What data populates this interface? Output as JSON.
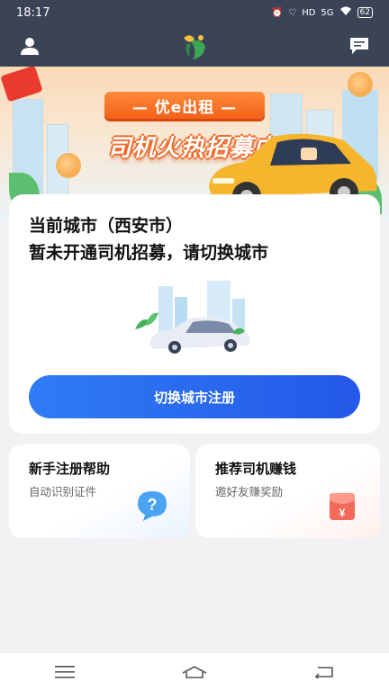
{
  "status_bar": {
    "time": "18:17",
    "network": "5G",
    "battery": "62"
  },
  "header": {
    "user_icon": "user-icon",
    "logo_icon": "app-logo",
    "message_icon": "message-icon"
  },
  "banner": {
    "brand": "— 优e出租 —",
    "headline": "司机火热招募中"
  },
  "city_card": {
    "title": "当前城市（西安市）",
    "subtitle": "暂未开通司机招募，请切换城市",
    "button_label": "切换城市注册"
  },
  "cards": [
    {
      "title": "新手注册帮助",
      "subtitle": "自动识别证件",
      "icon": "question-bubble-icon"
    },
    {
      "title": "推荐司机赚钱",
      "subtitle": "邀好友赚奖励",
      "icon": "red-envelope-icon"
    }
  ],
  "colors": {
    "header_bg": "#3b4357",
    "accent_blue": "#2f7cf6",
    "accent_orange": "#f2611a"
  },
  "nav": {
    "menu_icon": "menu-icon",
    "home_icon": "home-icon",
    "back_icon": "back-icon"
  }
}
